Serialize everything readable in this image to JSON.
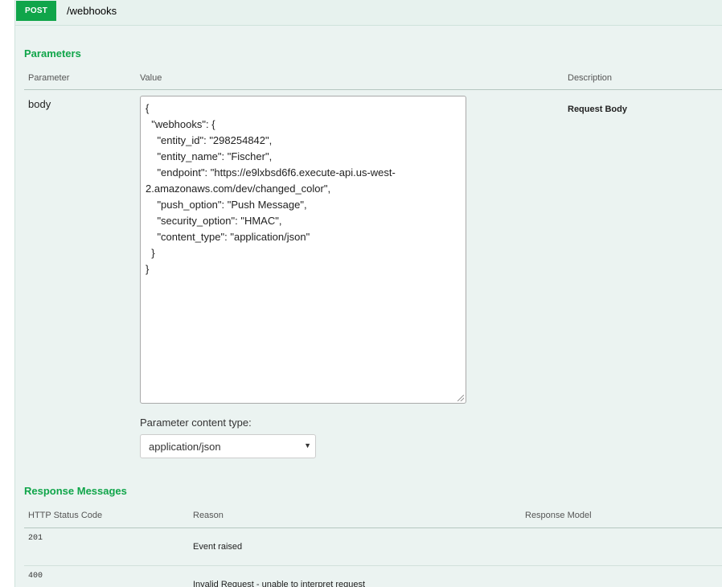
{
  "operation": {
    "method": "POST",
    "path": "/webhooks"
  },
  "parameters": {
    "title": "Parameters",
    "headers": {
      "parameter": "Parameter",
      "value": "Value",
      "description": "Description"
    },
    "row": {
      "name": "body",
      "value": "{\n  \"webhooks\": {\n    \"entity_id\": \"298254842\",\n    \"entity_name\": \"Fischer\",\n    \"endpoint\": \"https://e9lxbsd6f6.execute-api.us-west-\n2.amazonaws.com/dev/changed_color\",\n    \"push_option\": \"Push Message\",\n    \"security_option\": \"HMAC\",\n    \"content_type\": \"application/json\"\n  }\n}",
      "description": "Request Body"
    },
    "content_type_label": "Parameter content type:",
    "content_type_value": "application/json"
  },
  "responses": {
    "title": "Response Messages",
    "headers": {
      "status": "HTTP Status Code",
      "reason": "Reason",
      "model": "Response Model"
    },
    "rows": [
      {
        "code": "201",
        "reason": "Event raised"
      },
      {
        "code": "400",
        "reason": "Invalid Request - unable to interpret request"
      }
    ]
  }
}
